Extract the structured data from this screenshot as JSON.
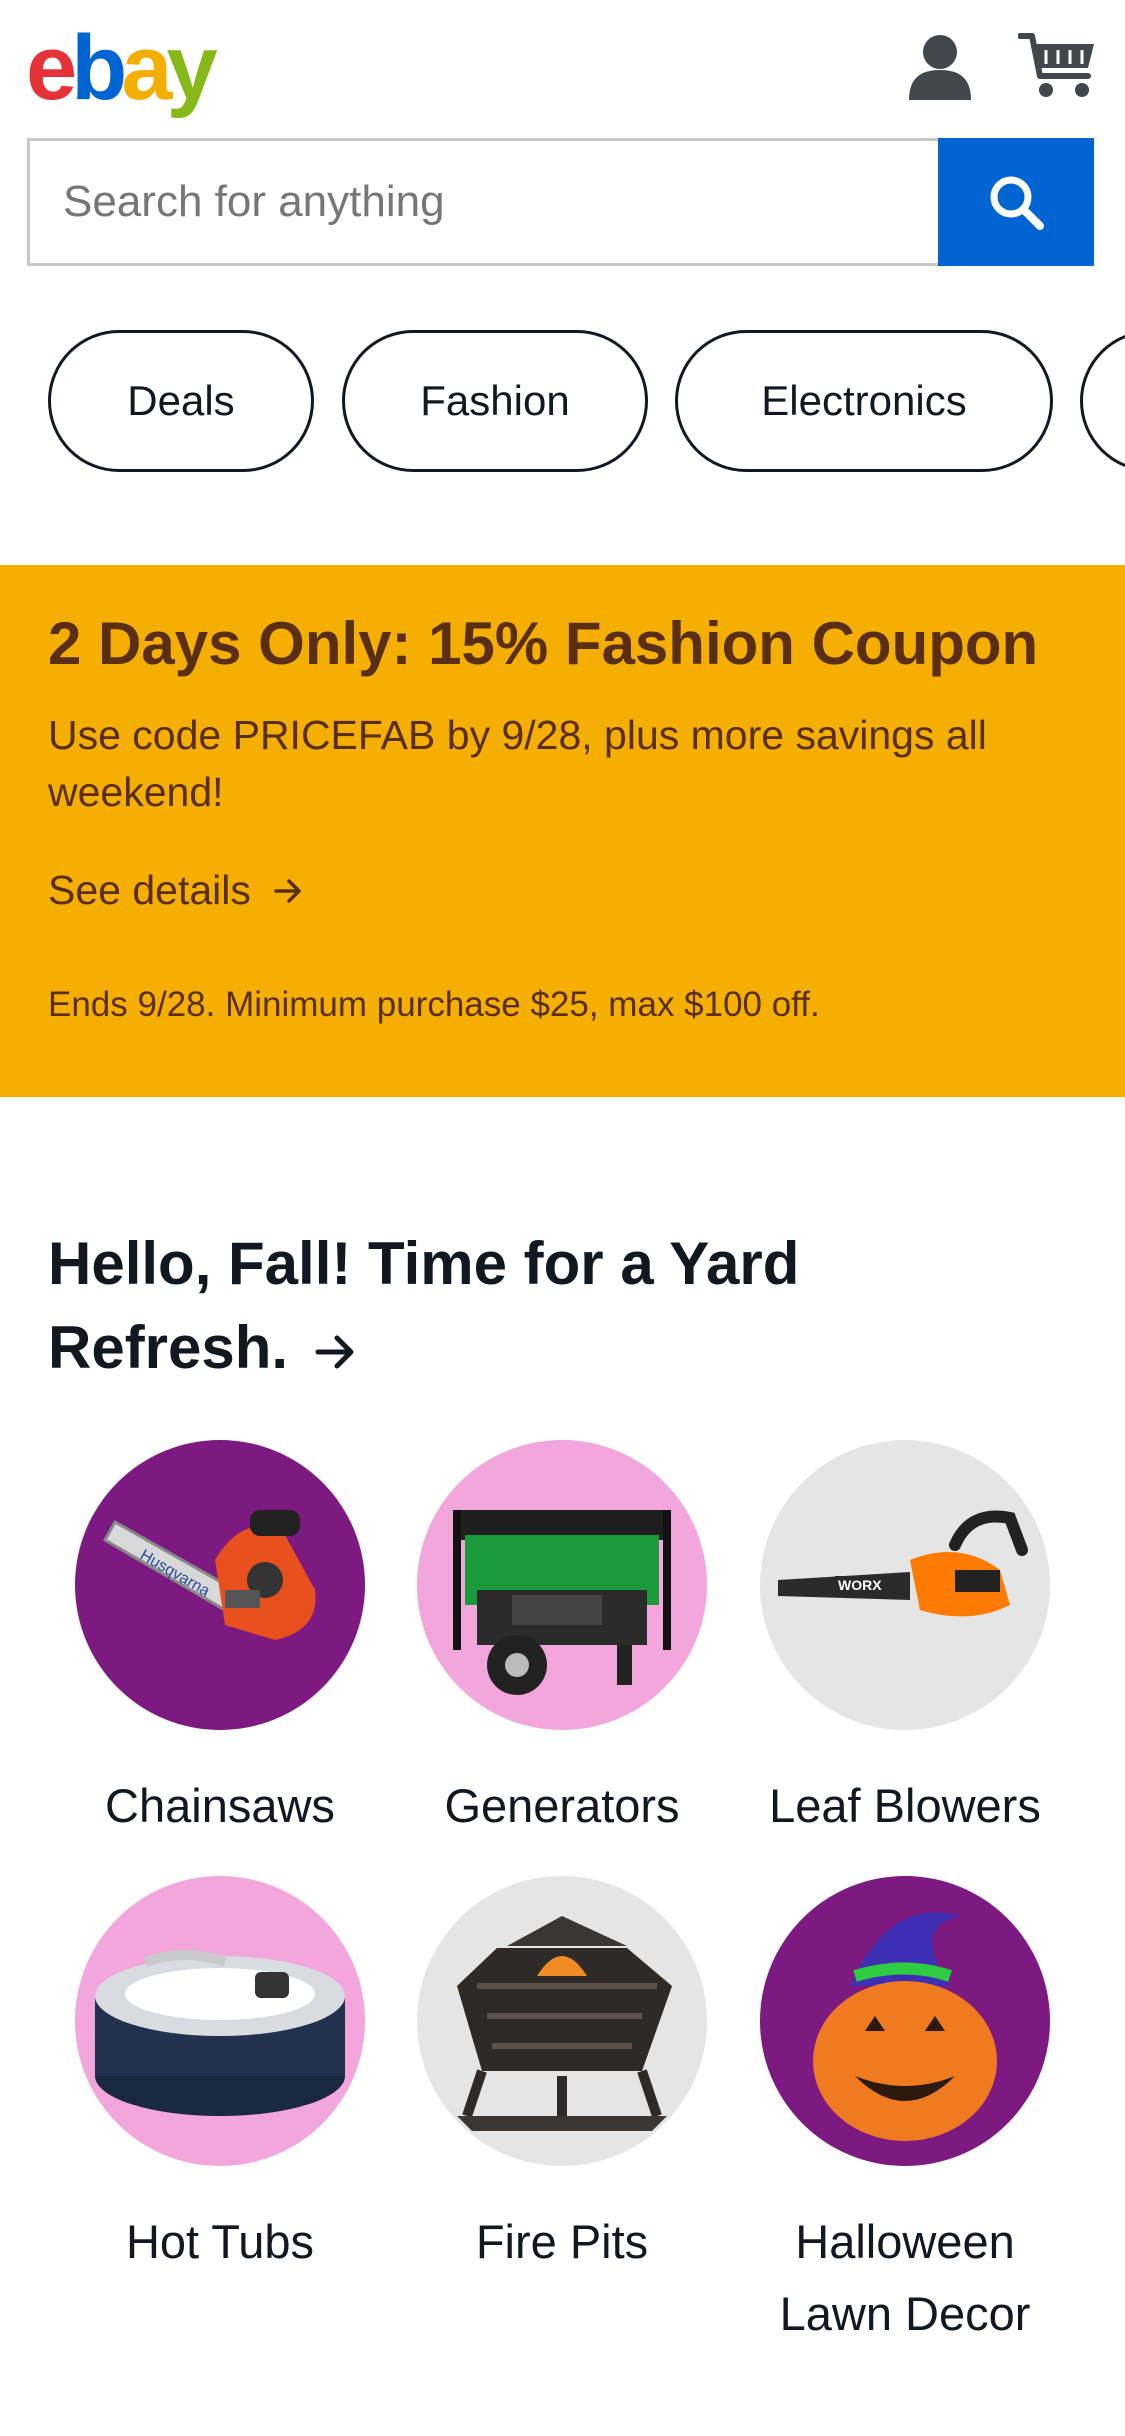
{
  "header": {
    "logo": [
      "e",
      "b",
      "a",
      "y"
    ],
    "icons": [
      "user-icon",
      "cart-icon"
    ]
  },
  "search": {
    "placeholder": "Search for anything",
    "button_icon": "search-icon"
  },
  "categories_nav": [
    "Deals",
    "Fashion",
    "Electronics",
    ""
  ],
  "promo": {
    "title": "2 Days Only: 15% Fashion Coupon",
    "subtitle": "Use code PRICEFAB by 9/28, plus more savings all weekend!",
    "link": "See details",
    "fine_print": "Ends 9/28. Minimum purchase $25, max $100 off.",
    "background": "#f5af02",
    "text_color": "#592e13"
  },
  "section": {
    "title": "Hello, Fall! Time for a Yard Refresh.",
    "items": [
      {
        "label": "Chainsaws",
        "bg": "#7c1a82",
        "image": "chainsaw"
      },
      {
        "label": "Generators",
        "bg": "#f2a6dc",
        "image": "generator"
      },
      {
        "label": "Leaf Blowers",
        "bg": "#e5e5e5",
        "image": "leaf-blower"
      },
      {
        "label": "Hot Tubs",
        "bg": "#f2a6dc",
        "image": "hot-tub"
      },
      {
        "label": "Fire Pits",
        "bg": "#e5e5e5",
        "image": "fire-pit"
      },
      {
        "label": "Halloween Lawn Decor",
        "bg": "#7c1a82",
        "image": "halloween-pumpkin"
      }
    ]
  },
  "colors": {
    "brand_blue": "#0064d2",
    "brand_red": "#e53238",
    "brand_yellow": "#f5af02",
    "brand_green": "#86b817"
  }
}
